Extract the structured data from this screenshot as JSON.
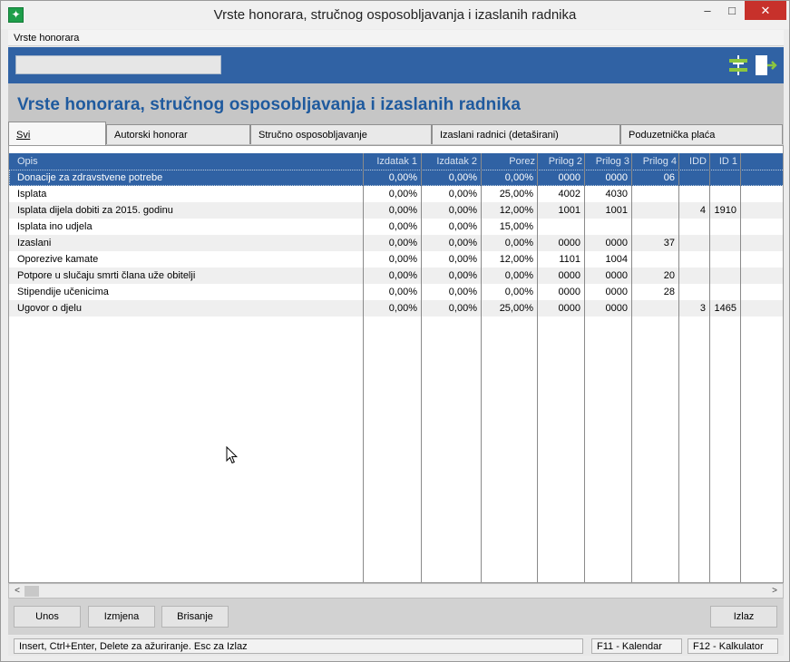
{
  "window": {
    "title": "Vrste honorara, stručnog osposobljavanja i izaslanih radnika",
    "controls": {
      "minimize": "–",
      "maximize": "□",
      "close": "✕"
    },
    "icon": "app-plus-icon"
  },
  "menu": {
    "items": [
      "Vrste honorara"
    ]
  },
  "toolbar": {
    "search": {
      "value": "",
      "placeholder": ""
    },
    "icons": [
      "filter-icon",
      "exit-icon"
    ]
  },
  "page": {
    "title": "Vrste honorara, stručnog osposobljavanja i izaslanih radnika"
  },
  "tabs": [
    {
      "label": "Svi",
      "active": true
    },
    {
      "label": "Autorski honorar",
      "active": false
    },
    {
      "label": "Stručno osposobljavanje",
      "active": false
    },
    {
      "label": "Izaslani radnici (detaširani)",
      "active": false
    },
    {
      "label": "Poduzetnička plaća",
      "active": false
    }
  ],
  "grid": {
    "columns": [
      "Opis",
      "Izdatak 1",
      "Izdatak 2",
      "Porez",
      "Prilog 2",
      "Prilog 3",
      "Prilog 4",
      "IDD",
      "ID 1"
    ],
    "rows": [
      {
        "opis": "Donacije za zdravstvene potrebe",
        "izdatak1": "0,00%",
        "izdatak2": "0,00%",
        "porez": "0,00%",
        "prilog2": "0000",
        "prilog3": "0000",
        "prilog4": "06",
        "idd": "",
        "id1": ""
      },
      {
        "opis": "Isplata",
        "izdatak1": "0,00%",
        "izdatak2": "0,00%",
        "porez": "25,00%",
        "prilog2": "4002",
        "prilog3": "4030",
        "prilog4": "",
        "idd": "",
        "id1": ""
      },
      {
        "opis": "Isplata dijela dobiti za 2015. godinu",
        "izdatak1": "0,00%",
        "izdatak2": "0,00%",
        "porez": "12,00%",
        "prilog2": "1001",
        "prilog3": "1001",
        "prilog4": "",
        "idd": "4",
        "id1": "1910"
      },
      {
        "opis": "Isplata ino udjela",
        "izdatak1": "0,00%",
        "izdatak2": "0,00%",
        "porez": "15,00%",
        "prilog2": "",
        "prilog3": "",
        "prilog4": "",
        "idd": "",
        "id1": ""
      },
      {
        "opis": "Izaslani",
        "izdatak1": "0,00%",
        "izdatak2": "0,00%",
        "porez": "0,00%",
        "prilog2": "0000",
        "prilog3": "0000",
        "prilog4": "37",
        "idd": "",
        "id1": ""
      },
      {
        "opis": "Oporezive kamate",
        "izdatak1": "0,00%",
        "izdatak2": "0,00%",
        "porez": "12,00%",
        "prilog2": "1101",
        "prilog3": "1004",
        "prilog4": "",
        "idd": "",
        "id1": ""
      },
      {
        "opis": "Potpore u slučaju smrti člana uže obitelji",
        "izdatak1": "0,00%",
        "izdatak2": "0,00%",
        "porez": "0,00%",
        "prilog2": "0000",
        "prilog3": "0000",
        "prilog4": "20",
        "idd": "",
        "id1": ""
      },
      {
        "opis": "Stipendije učenicima",
        "izdatak1": "0,00%",
        "izdatak2": "0,00%",
        "porez": "0,00%",
        "prilog2": "0000",
        "prilog3": "0000",
        "prilog4": "28",
        "idd": "",
        "id1": ""
      },
      {
        "opis": "Ugovor o djelu",
        "izdatak1": "0,00%",
        "izdatak2": "0,00%",
        "porez": "25,00%",
        "prilog2": "0000",
        "prilog3": "0000",
        "prilog4": "",
        "idd": "3",
        "id1": "1465"
      }
    ],
    "selected_row": 0
  },
  "scrollbar": {
    "left_arrow": "<",
    "right_arrow": ">"
  },
  "buttons": {
    "unos": "Unos",
    "izmjena": "Izmjena",
    "brisanje": "Brisanje",
    "izlaz": "Izlaz"
  },
  "status": {
    "main": "Insert, Ctrl+Enter, Delete za ažuriranje. Esc za Izlaz",
    "f11": "F11 - Kalendar",
    "f12": "F12 - Kalkulator"
  },
  "colors": {
    "accent_blue": "#3062a4",
    "title_blue": "#1f5a9e",
    "close_red": "#c7312b",
    "app_green": "#1e9e4a"
  }
}
